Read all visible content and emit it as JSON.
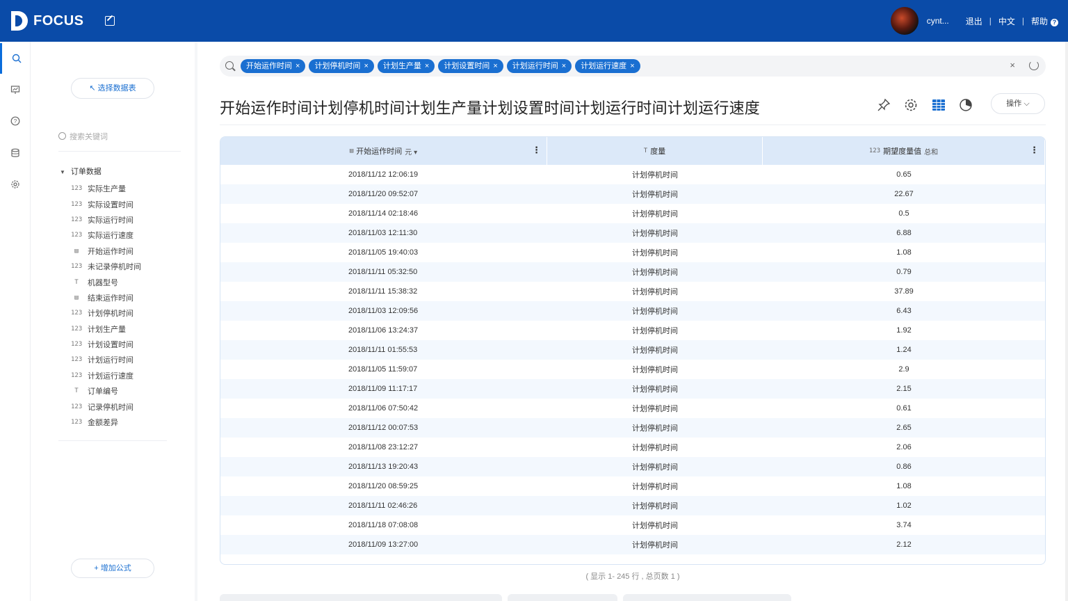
{
  "app": {
    "logo_text": "FOCUS",
    "user_name": "cynt...",
    "logout": "退出",
    "language": "中文",
    "help": "帮助",
    "colors": {
      "topbar": "#0a4ba8",
      "accent": "#1a6fd1"
    }
  },
  "rail": [
    {
      "icon": "search-icon",
      "active": true
    },
    {
      "icon": "board-icon",
      "active": false
    },
    {
      "icon": "help-circle-icon",
      "active": false
    },
    {
      "icon": "database-icon",
      "active": false
    },
    {
      "icon": "gear-icon",
      "active": false
    }
  ],
  "datapanel": {
    "select_dataset": "↖ 选择数据表",
    "search_placeholder": "搜索关键词",
    "root_label": "订单数据",
    "fields": [
      {
        "type": "number",
        "label": "实际生产量"
      },
      {
        "type": "number",
        "label": "实际设置时间"
      },
      {
        "type": "number",
        "label": "实际运行时间"
      },
      {
        "type": "number",
        "label": "实际运行速度"
      },
      {
        "type": "date",
        "label": "开始运作时间"
      },
      {
        "type": "number",
        "label": "未记录停机时间"
      },
      {
        "type": "text",
        "label": "机器型号"
      },
      {
        "type": "date",
        "label": "结束运作时间"
      },
      {
        "type": "number",
        "label": "计划停机时间"
      },
      {
        "type": "number",
        "label": "计划生产量"
      },
      {
        "type": "number",
        "label": "计划设置时间"
      },
      {
        "type": "number",
        "label": "计划运行时间"
      },
      {
        "type": "number",
        "label": "计划运行速度"
      },
      {
        "type": "text",
        "label": "订单编号"
      },
      {
        "type": "number",
        "label": "记录停机时间"
      },
      {
        "type": "number",
        "label": "金额差异"
      }
    ],
    "add_formula": "+ 增加公式"
  },
  "search": {
    "tokens": [
      "开始运作时间",
      "计划停机时间",
      "计划生产量",
      "计划设置时间",
      "计划运行时间",
      "计划运行速度"
    ],
    "clear": "×"
  },
  "main": {
    "title": "开始运作时间计划停机时间计划生产量计划设置时间计划运行时间计划运行速度",
    "ops_label": "操作 ⌵"
  },
  "table": {
    "headers": [
      {
        "label": "开始运作时间",
        "sub": "元 ▾"
      },
      {
        "label": "度量",
        "sub": ""
      },
      {
        "label": "期望度量值",
        "sub": "总和"
      }
    ],
    "rows": [
      [
        "2018/11/12 12:06:19",
        "计划停机时间",
        "0.65"
      ],
      [
        "2018/11/20 09:52:07",
        "计划停机时间",
        "22.67"
      ],
      [
        "2018/11/14 02:18:46",
        "计划停机时间",
        "0.5"
      ],
      [
        "2018/11/03 12:11:30",
        "计划停机时间",
        "6.88"
      ],
      [
        "2018/11/05 19:40:03",
        "计划停机时间",
        "1.08"
      ],
      [
        "2018/11/11 05:32:50",
        "计划停机时间",
        "0.79"
      ],
      [
        "2018/11/11 15:38:32",
        "计划停机时间",
        "37.89"
      ],
      [
        "2018/11/03 12:09:56",
        "计划停机时间",
        "6.43"
      ],
      [
        "2018/11/06 13:24:37",
        "计划停机时间",
        "1.92"
      ],
      [
        "2018/11/11 01:55:53",
        "计划停机时间",
        "1.24"
      ],
      [
        "2018/11/05 11:59:07",
        "计划停机时间",
        "2.9"
      ],
      [
        "2018/11/09 11:17:17",
        "计划停机时间",
        "2.15"
      ],
      [
        "2018/11/06 07:50:42",
        "计划停机时间",
        "0.61"
      ],
      [
        "2018/11/12 00:07:53",
        "计划停机时间",
        "2.65"
      ],
      [
        "2018/11/08 23:12:27",
        "计划停机时间",
        "2.06"
      ],
      [
        "2018/11/13 19:20:43",
        "计划停机时间",
        "0.86"
      ],
      [
        "2018/11/20 08:59:25",
        "计划停机时间",
        "1.08"
      ],
      [
        "2018/11/11 02:46:26",
        "计划停机时间",
        "1.02"
      ],
      [
        "2018/11/18 07:08:08",
        "计划停机时间",
        "3.74"
      ],
      [
        "2018/11/09 13:27:00",
        "计划停机时间",
        "2.12"
      ]
    ],
    "pager": "( 显示 1- 245 行 , 总页数 1 )"
  }
}
